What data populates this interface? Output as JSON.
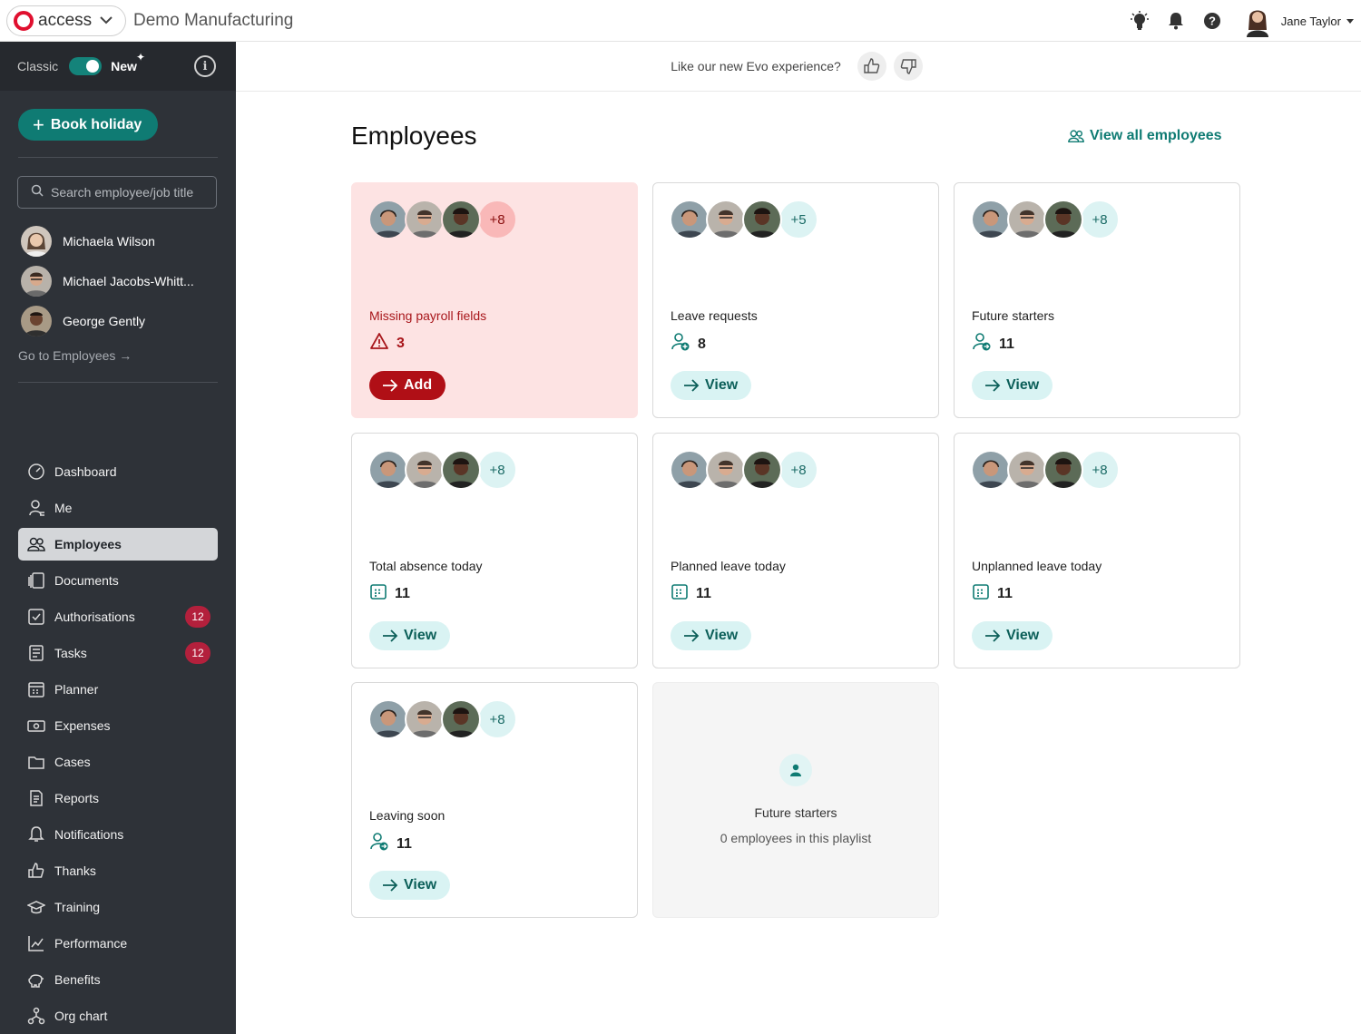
{
  "header": {
    "brand": "access",
    "company": "Demo Manufacturing",
    "user_name": "Jane Taylor"
  },
  "sidebar": {
    "toggle_classic": "Classic",
    "toggle_new": "New",
    "book_holiday": "Book holiday",
    "search_placeholder": "Search employee/job title",
    "recent": [
      "Michaela Wilson",
      "Michael Jacobs-Whitt...",
      "George Gently"
    ],
    "go_to_employees": "Go to Employees →",
    "nav": [
      {
        "label": "Dashboard",
        "icon": "gauge-icon"
      },
      {
        "label": "Me",
        "icon": "person-icon"
      },
      {
        "label": "Employees",
        "icon": "people-icon",
        "active": true
      },
      {
        "label": "Documents",
        "icon": "documents-icon"
      },
      {
        "label": "Authorisations",
        "icon": "check-square-icon",
        "badge": "12"
      },
      {
        "label": "Tasks",
        "icon": "tasks-icon",
        "badge": "12"
      },
      {
        "label": "Planner",
        "icon": "calendar-icon"
      },
      {
        "label": "Expenses",
        "icon": "money-icon"
      },
      {
        "label": "Cases",
        "icon": "folder-icon"
      },
      {
        "label": "Reports",
        "icon": "report-icon"
      },
      {
        "label": "Notifications",
        "icon": "bell-icon"
      },
      {
        "label": "Thanks",
        "icon": "thumbs-up-icon"
      },
      {
        "label": "Training",
        "icon": "graduation-cap-icon"
      },
      {
        "label": "Performance",
        "icon": "chart-line-icon"
      },
      {
        "label": "Benefits",
        "icon": "piggy-bank-icon"
      },
      {
        "label": "Org chart",
        "icon": "org-chart-icon"
      }
    ]
  },
  "feedback": {
    "question": "Like our new Evo experience?"
  },
  "main": {
    "title": "Employees",
    "view_all": "View all employees",
    "cards": [
      {
        "title": "Missing payroll fields",
        "more": "+8",
        "count": "3",
        "button": "Add",
        "variant": "alert",
        "count_icon": "warning-icon"
      },
      {
        "title": "Leave requests",
        "more": "+5",
        "count": "8",
        "button": "View",
        "count_icon": "person-add-icon"
      },
      {
        "title": "Future starters",
        "more": "+8",
        "count": "11",
        "button": "View",
        "count_icon": "person-arrow-icon"
      },
      {
        "title": "Total absence today",
        "more": "+8",
        "count": "11",
        "button": "View",
        "count_icon": "calendar-icon"
      },
      {
        "title": "Planned leave today",
        "more": "+8",
        "count": "11",
        "button": "View",
        "count_icon": "calendar-icon"
      },
      {
        "title": "Unplanned leave today",
        "more": "+8",
        "count": "11",
        "button": "View",
        "count_icon": "calendar-icon"
      },
      {
        "title": "Leaving soon",
        "more": "+8",
        "count": "11",
        "button": "View",
        "count_icon": "person-arrow-icon"
      }
    ],
    "empty_card": {
      "title": "Future starters",
      "subtitle": "0 employees in this playlist"
    }
  },
  "colors": {
    "accent": "#0f7b73",
    "sidebar_bg": "#2e3238",
    "alert_bg": "#fde3e3",
    "alert_text": "#a8161b",
    "badge": "#b3203c"
  }
}
